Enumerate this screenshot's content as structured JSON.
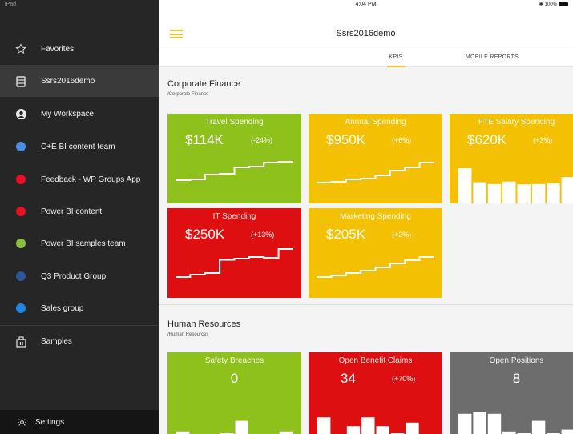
{
  "status": {
    "device": "iPad",
    "time": "4:04 PM",
    "battery": "100%"
  },
  "app": {
    "title": "Ssrs2016demo"
  },
  "tabs": [
    {
      "label": "KPIS"
    },
    {
      "label": "MOBILE REPORTS"
    }
  ],
  "sidebar": {
    "items": [
      {
        "label": "Favorites",
        "icon": "star-icon"
      },
      {
        "label": "Ssrs2016demo",
        "icon": "server-icon"
      },
      {
        "label": "My Workspace",
        "icon": "user-icon"
      },
      {
        "label": "C+E BI content team",
        "color": "#4a90e2"
      },
      {
        "label": "Feedback - WP Groups App",
        "color": "#e81123"
      },
      {
        "label": "Power BI content",
        "color": "#e81123"
      },
      {
        "label": "Power BI samples team",
        "color": "#8cbd3f"
      },
      {
        "label": "Q3 Product Group",
        "color": "#2b579a"
      },
      {
        "label": "Sales group",
        "color": "#1e88e5"
      },
      {
        "label": "Samples",
        "icon": "samples-icon"
      }
    ],
    "settings": {
      "label": "Settings",
      "icon": "gear-icon"
    }
  },
  "sections": [
    {
      "title": "Corporate Finance",
      "subtitle": "/Corporate Finance",
      "tiles": [
        {
          "title": "Travel Spending",
          "value": "$114K",
          "change": "(-24%)",
          "color": "#8fc11c",
          "chart": "step",
          "trend": [
            0.18,
            0.2,
            0.32,
            0.34,
            0.5,
            0.52,
            0.62,
            0.64
          ]
        },
        {
          "title": "Annual Spending",
          "value": "$950K",
          "change": "(+6%)",
          "color": "#f4c004",
          "chart": "step",
          "trend": [
            0.12,
            0.14,
            0.2,
            0.22,
            0.3,
            0.42,
            0.5,
            0.62
          ]
        },
        {
          "title": "FTE Salary Spending",
          "value": "$620K",
          "change": "(+3%)",
          "color": "#f4c004",
          "chart": "bar",
          "trend": [
            1.0,
            0.6,
            0.55,
            0.62,
            0.54,
            0.55,
            0.57,
            0.75
          ]
        },
        {
          "title": "IT Spending",
          "value": "$250K",
          "change": "(+13%)",
          "color": "#dd0f10",
          "chart": "step",
          "trend": [
            0.12,
            0.18,
            0.22,
            0.55,
            0.58,
            0.62,
            0.6,
            0.82
          ]
        },
        {
          "title": "Marketing Spending",
          "value": "$205K",
          "change": "(+2%)",
          "color": "#f4c004",
          "chart": "step",
          "trend": [
            0.12,
            0.16,
            0.22,
            0.28,
            0.36,
            0.46,
            0.54,
            0.62
          ]
        }
      ]
    },
    {
      "title": "Human Resources",
      "subtitle": "/Human Resources",
      "tiles": [
        {
          "title": "Safety Breaches",
          "value": "0",
          "change": "",
          "color": "#8fc11c",
          "chart": "bar",
          "trend": [
            0.3,
            0,
            0,
            0.25,
            0.6,
            0,
            0,
            0.3
          ]
        },
        {
          "title": "Open Benefit Claims",
          "value": "34",
          "change": "(+70%)",
          "color": "#dd0f10",
          "chart": "bar",
          "trend": [
            0.7,
            0.2,
            0.45,
            0.7,
            0.45,
            0.25,
            0.55,
            0.2
          ]
        },
        {
          "title": "Open Positions",
          "value": "8",
          "change": "",
          "color": "#6d6d6d",
          "chart": "bar",
          "trend": [
            0.8,
            0.85,
            0.8,
            0.3,
            0.25,
            0.6,
            0.25,
            0.35
          ]
        }
      ]
    }
  ]
}
